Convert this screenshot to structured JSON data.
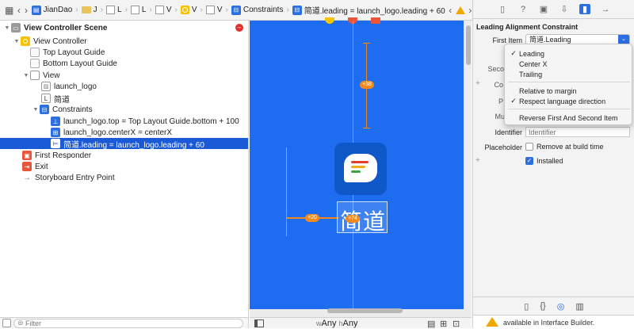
{
  "jump_bar": {
    "crumbs": [
      "JianDao",
      "J",
      "L",
      "L",
      "V",
      "V",
      "V",
      "Constraints",
      "简道.leading = launch_logo.leading + 60"
    ]
  },
  "outline": {
    "rows": [
      {
        "label": "View Controller Scene"
      },
      {
        "label": "View Controller"
      },
      {
        "label": "Top Layout Guide"
      },
      {
        "label": "Bottom Layout Guide"
      },
      {
        "label": "View"
      },
      {
        "label": "launch_logo"
      },
      {
        "label": "简道",
        "badge": "L"
      },
      {
        "label": "Constraints"
      },
      {
        "label": "launch_logo.top = Top Layout Guide.bottom + 100"
      },
      {
        "label": "launch_logo.centerX = centerX"
      },
      {
        "label": "简道.leading = launch_logo.leading + 60"
      },
      {
        "label": "First Responder"
      },
      {
        "label": "Exit"
      },
      {
        "label": "Storyboard Entry Point"
      }
    ]
  },
  "filter": {
    "placeholder": "Filter"
  },
  "canvas": {
    "label_text": "简道",
    "badge_top": "+38",
    "badge_left": "+20",
    "badge_mid": "+74",
    "size_w_prefix": "w",
    "size_w": "Any",
    "size_h_prefix": "h",
    "size_h": "Any"
  },
  "inspector": {
    "title": "Leading Alignment Constraint",
    "first_item_label": "First Item",
    "first_item_value": "简道.Leading",
    "relation_label": "R",
    "second_item_label": "Secon",
    "constant_label": "Co",
    "priority_label": "P",
    "multiplier_label": "Mu",
    "identifier_label": "Identifier",
    "identifier_placeholder": "Identifier",
    "placeholder_label": "Placeholder",
    "placeholder_check": "Remove at build time",
    "installed_check": "Installed",
    "bottom_text": "available in Interface Builder."
  },
  "popup": {
    "items": [
      {
        "label": "Leading",
        "checked": "✓"
      },
      {
        "label": "Center X",
        "checked": ""
      },
      {
        "label": "Trailing",
        "checked": ""
      },
      {
        "label": "Relative to margin",
        "checked": ""
      },
      {
        "label": "Respect language direction",
        "checked": "✓"
      },
      {
        "label": "Reverse First And Second Item",
        "checked": ""
      }
    ]
  },
  "colors": {
    "canvas_blue": "#1e6df0",
    "selection_blue": "#1a5ad6",
    "constraint_orange": "#f08a1c",
    "warning_yellow": "#f0a800"
  }
}
